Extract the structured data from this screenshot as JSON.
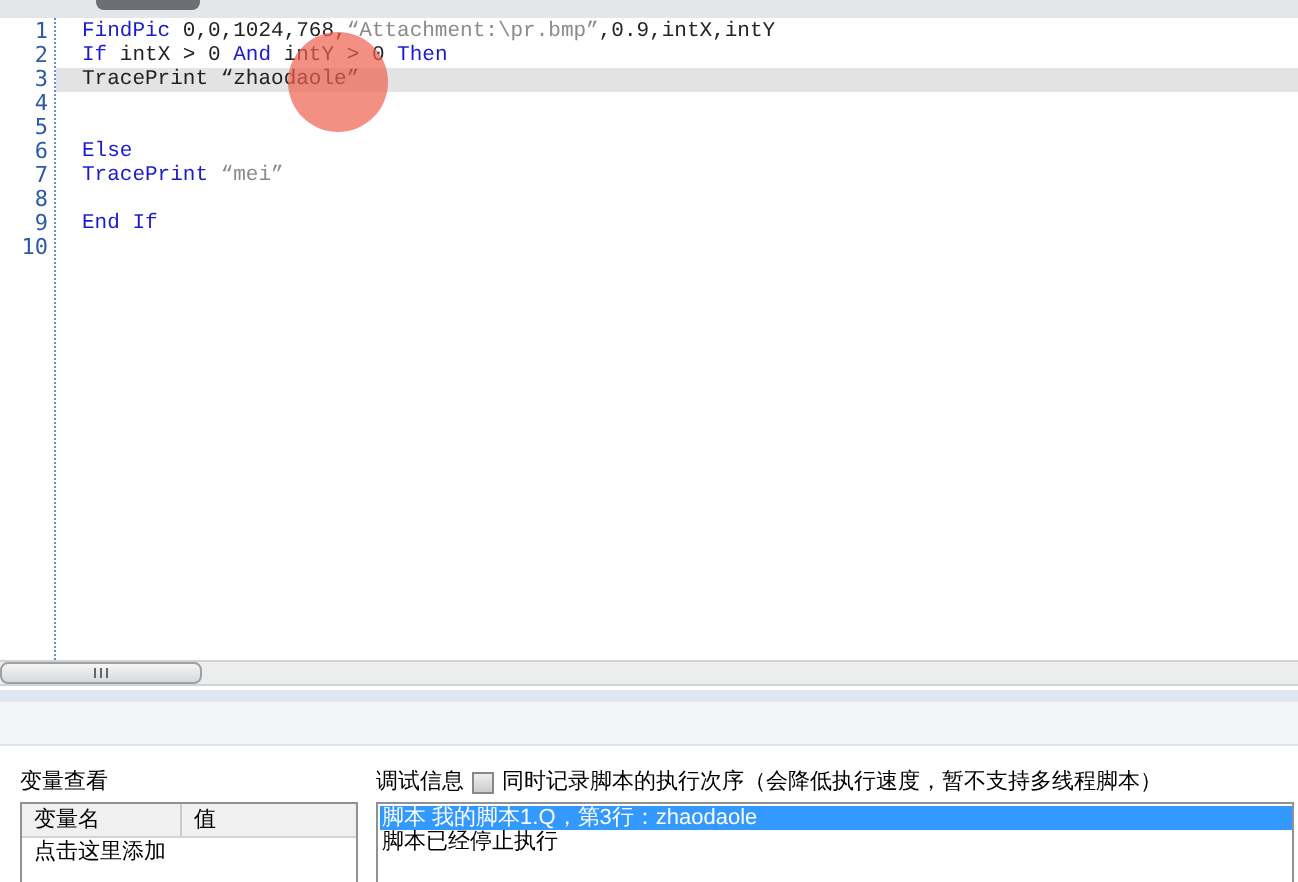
{
  "editor": {
    "lines": [
      {
        "number": "1",
        "tokens": [
          {
            "kind": "keyword",
            "text": "FindPic"
          },
          {
            "kind": "plain",
            "text": " 0,0,1024,768,"
          },
          {
            "kind": "string",
            "text": "“Attachment:\\pr.bmp”"
          },
          {
            "kind": "plain",
            "text": ",0.9,intX,intY"
          }
        ]
      },
      {
        "number": "2",
        "tokens": [
          {
            "kind": "keyword",
            "text": "If"
          },
          {
            "kind": "plain",
            "text": " intX > 0 "
          },
          {
            "kind": "keyword",
            "text": "And"
          },
          {
            "kind": "plain",
            "text": " intY > 0 "
          },
          {
            "kind": "keyword",
            "text": "Then"
          }
        ]
      },
      {
        "number": "3",
        "current": true,
        "tokens": [
          {
            "kind": "plain",
            "text": "TracePrint "
          },
          {
            "kind": "plain",
            "text": "“zhaodaole”"
          }
        ]
      },
      {
        "number": "4"
      },
      {
        "number": "5"
      },
      {
        "number": "6",
        "tokens": [
          {
            "kind": "keyword",
            "text": "Else"
          }
        ]
      },
      {
        "number": "7",
        "tokens": [
          {
            "kind": "keyword",
            "text": "TracePrint"
          },
          {
            "kind": "string",
            "text": "“mei”",
            "spaced": true
          }
        ]
      },
      {
        "number": "8"
      },
      {
        "number": "9",
        "tokens": [
          {
            "kind": "keyword",
            "text": "End If"
          }
        ]
      },
      {
        "number": "10"
      }
    ]
  },
  "variables": {
    "title": "变量查看",
    "columns": [
      "变量名",
      "值"
    ],
    "rows": [
      [
        "点击这里添加",
        ""
      ]
    ]
  },
  "debug": {
    "title": "调试信息",
    "option": {
      "label": "同时记录脚本的执行次序（会降低执行速度，暂不支持多线程脚本）",
      "checked": false
    },
    "messages": [
      {
        "text": "脚本 我的脚本1.Q，第3行：zhaodaole",
        "selected": true
      },
      {
        "text": "脚本已经停止执行",
        "selected": false
      }
    ]
  }
}
